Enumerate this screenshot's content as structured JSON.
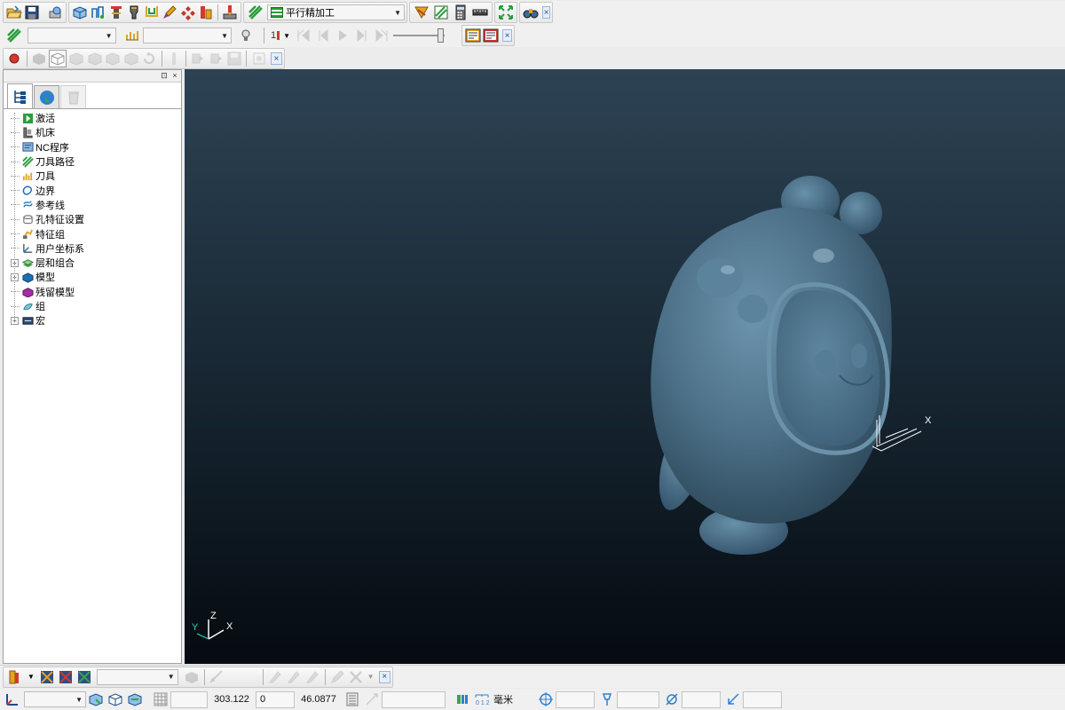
{
  "toolbar1": {
    "strategy_value": "平行精加工",
    "close_label": "×",
    "icons": [
      "open-folder",
      "save",
      "print-preview",
      "model-block",
      "feature-set",
      "tool-def",
      "boundary-def",
      "drill-tool",
      "pattern",
      "toolpath-verify",
      "leads-links",
      "strategy",
      "simulate",
      "calculator",
      "ruler",
      "multi-axis",
      "binoculars"
    ]
  },
  "toolbar2": {
    "toolpath_select": "",
    "tool_select": "",
    "step_label": "1",
    "close_label": "×"
  },
  "toolbar3": {
    "close_label": "×"
  },
  "panel": {
    "float_label": "⊡",
    "close_label": "×",
    "tree": [
      {
        "label": "激活",
        "icon": "activate-icon",
        "expandable": false
      },
      {
        "label": "机床",
        "icon": "machine-icon",
        "expandable": false
      },
      {
        "label": "NC程序",
        "icon": "nc-program-icon",
        "expandable": false
      },
      {
        "label": "刀具路径",
        "icon": "toolpath-icon",
        "expandable": false
      },
      {
        "label": "刀具",
        "icon": "tool-icon",
        "expandable": false
      },
      {
        "label": "边界",
        "icon": "boundary-icon",
        "expandable": false
      },
      {
        "label": "参考线",
        "icon": "pattern-icon",
        "expandable": false
      },
      {
        "label": "孔特征设置",
        "icon": "hole-feature-icon",
        "expandable": false
      },
      {
        "label": "特征组",
        "icon": "feature-group-icon",
        "expandable": false
      },
      {
        "label": "用户坐标系",
        "icon": "workplane-icon",
        "expandable": false
      },
      {
        "label": "层和组合",
        "icon": "layers-icon",
        "expandable": true
      },
      {
        "label": "模型",
        "icon": "model-icon",
        "expandable": true
      },
      {
        "label": "残留模型",
        "icon": "stock-model-icon",
        "expandable": false
      },
      {
        "label": "组",
        "icon": "group-icon",
        "expandable": false
      },
      {
        "label": "宏",
        "icon": "macro-icon",
        "expandable": true
      }
    ]
  },
  "viewport": {
    "axis_x": "X",
    "axis_y": "Y",
    "axis_z": "Z",
    "workplane_x": "X"
  },
  "status": {
    "x_value": "303.122",
    "y_value": "0",
    "z_value": "46.0877",
    "units": "毫米",
    "field_blank": "",
    "close_label": "×"
  },
  "colors": {
    "model": "#4b6f86",
    "viewport_top": "#2d4354",
    "viewport_bottom": "#050b10"
  }
}
